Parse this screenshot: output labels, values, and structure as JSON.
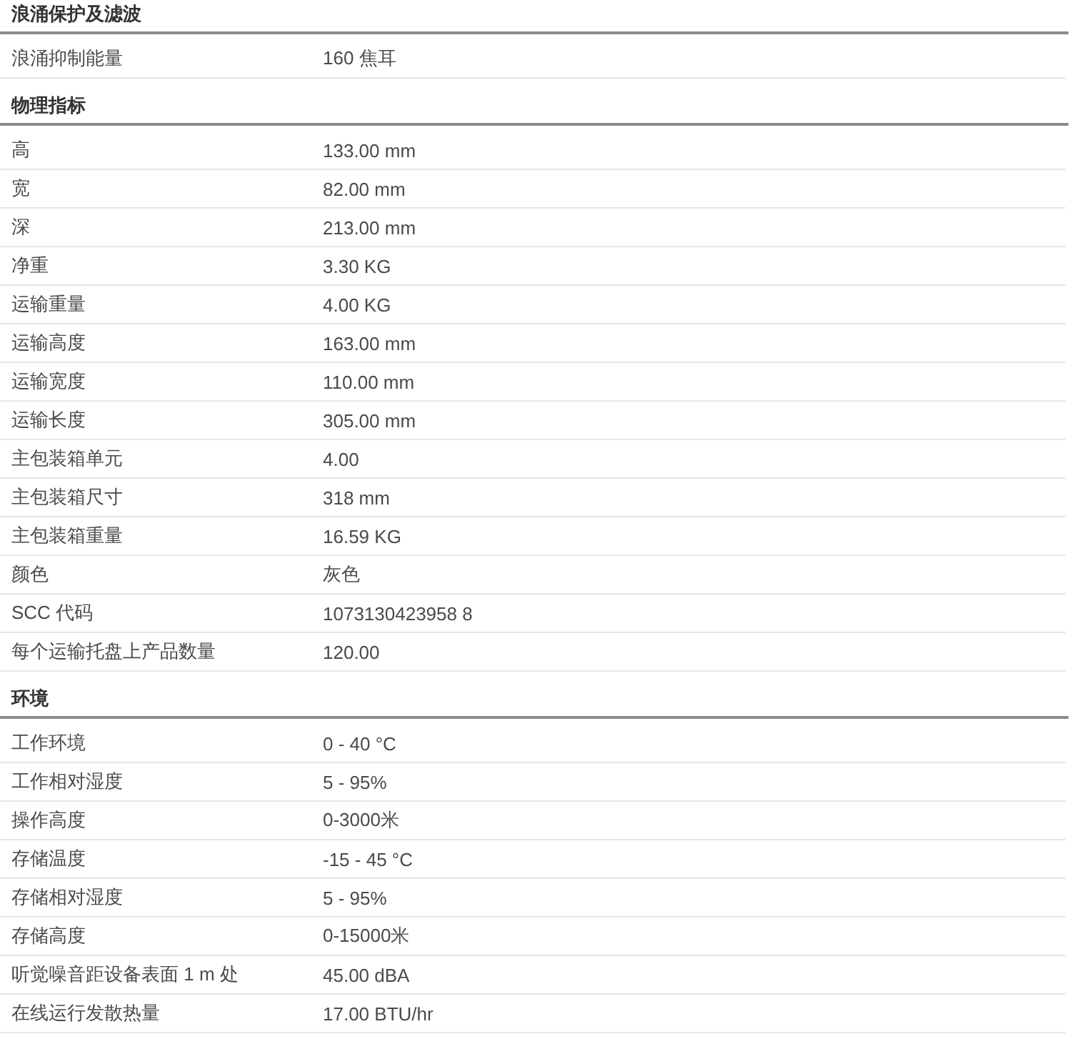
{
  "sections": [
    {
      "title": "浪涌保护及滤波",
      "rows": [
        {
          "label": "浪涌抑制能量",
          "value": "160 焦耳"
        }
      ]
    },
    {
      "title": "物理指标",
      "rows": [
        {
          "label": "高",
          "value": "133.00 mm"
        },
        {
          "label": "宽",
          "value": "82.00 mm"
        },
        {
          "label": "深",
          "value": "213.00 mm"
        },
        {
          "label": "净重",
          "value": "3.30 KG"
        },
        {
          "label": "运输重量",
          "value": "4.00 KG"
        },
        {
          "label": "运输高度",
          "value": "163.00 mm"
        },
        {
          "label": "运输宽度",
          "value": "110.00 mm"
        },
        {
          "label": "运输长度",
          "value": "305.00 mm"
        },
        {
          "label": "主包装箱单元",
          "value": "4.00"
        },
        {
          "label": "主包装箱尺寸",
          "value": "318 mm"
        },
        {
          "label": "主包装箱重量",
          "value": "16.59 KG"
        },
        {
          "label": "颜色",
          "value": "灰色"
        },
        {
          "label": "SCC 代码",
          "value": "1073130423958 8"
        },
        {
          "label": "每个运输托盘上产品数量",
          "value": "120.00"
        }
      ]
    },
    {
      "title": "环境",
      "rows": [
        {
          "label": "工作环境",
          "value": "0 - 40 °C"
        },
        {
          "label": "工作相对湿度",
          "value": "5 - 95%"
        },
        {
          "label": "操作高度",
          "value": "0-3000米"
        },
        {
          "label": "存储温度",
          "value": "-15 - 45 °C"
        },
        {
          "label": "存储相对湿度",
          "value": "5 - 95%"
        },
        {
          "label": "存储高度",
          "value": "0-15000米"
        },
        {
          "label": "听觉噪音距设备表面 1 m 处",
          "value": "45.00 dBA"
        },
        {
          "label": "在线运行发散热量",
          "value": "17.00 BTU/hr"
        }
      ]
    }
  ]
}
